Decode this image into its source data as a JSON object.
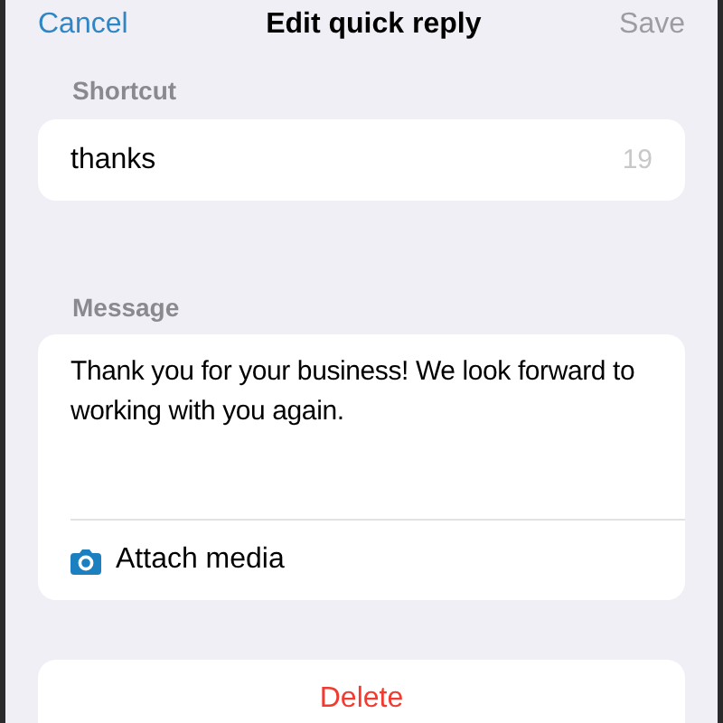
{
  "nav": {
    "cancel": "Cancel",
    "title": "Edit quick reply",
    "save": "Save",
    "save_disabled": true
  },
  "shortcut": {
    "label": "Shortcut",
    "value": "thanks",
    "counter": "19"
  },
  "message": {
    "label": "Message",
    "value": "Thank you for your business! We look forward to working with you again.",
    "attach": "Attach media"
  },
  "delete": "Delete"
}
